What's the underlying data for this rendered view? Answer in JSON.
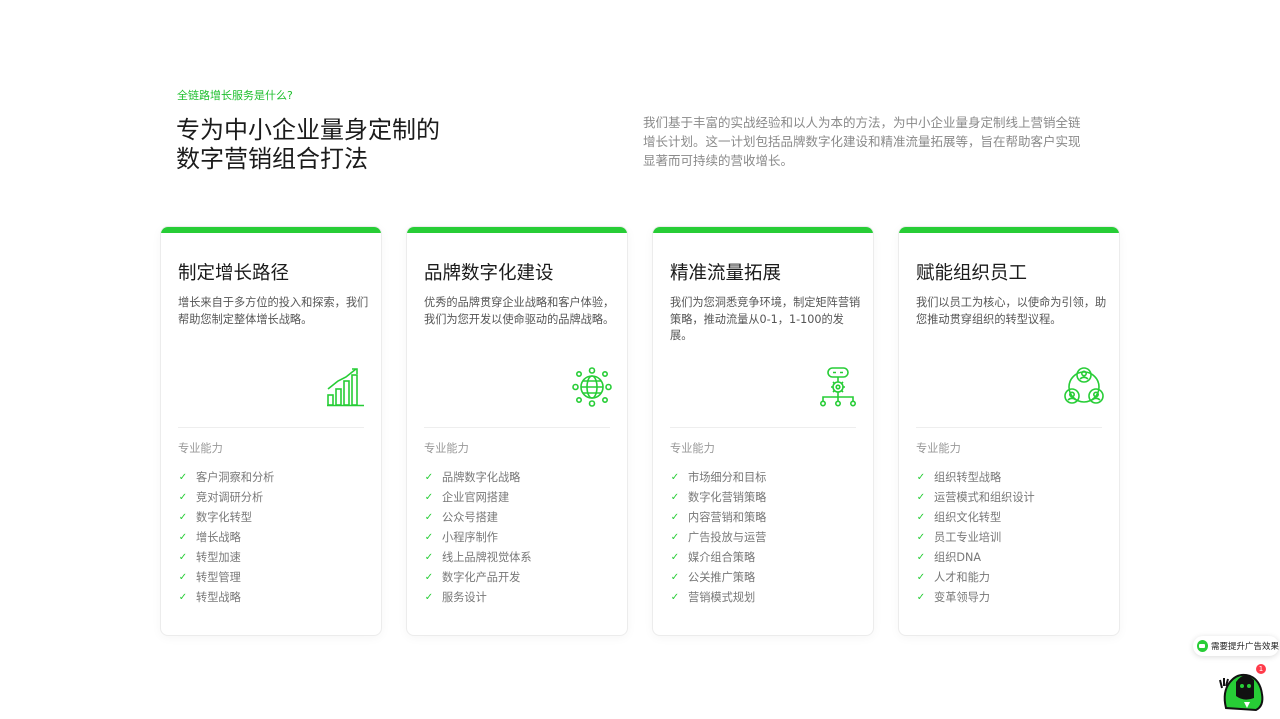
{
  "hero": {
    "eyebrow": "全链路增长服务是什么?",
    "title_line1": "专为中小企业量身定制的",
    "title_line2": "数字营销组合打法",
    "description": "我们基于丰富的实战经验和以人为本的方法，为中小企业量身定制线上营销全链增长计划。这一计划包括品牌数字化建设和精准流量拓展等，旨在帮助客户实现显著而可持续的营收增长。"
  },
  "theme": {
    "accent": "#27cd36",
    "eyebrow_color": "#1fbf2e"
  },
  "cards": [
    {
      "title": "制定增长路径",
      "description": "增长来自于多方位的投入和探索，我们帮助您制定整体增长战略。",
      "icon": "growth-chart-icon",
      "capability_label": "专业能力",
      "items": [
        "客户洞察和分析",
        "竞对调研分析",
        "数字化转型",
        "增长战略",
        "转型加速",
        "转型管理",
        "转型战略"
      ]
    },
    {
      "title": "品牌数字化建设",
      "description": "优秀的品牌贯穿企业战略和客户体验，我们为您开发以使命驱动的品牌战略。",
      "icon": "globe-network-icon",
      "capability_label": "专业能力",
      "items": [
        "品牌数字化战略",
        "企业官网搭建",
        "公众号搭建",
        "小程序制作",
        "线上品牌视觉体系",
        "数字化产品开发",
        "服务设计"
      ]
    },
    {
      "title": "精准流量拓展",
      "description": "我们为您洞悉竞争环境，制定矩阵营销策略，推动流量从0-1，1-100的发展。",
      "icon": "gear-network-icon",
      "capability_label": "专业能力",
      "items": [
        "市场细分和目标",
        "数字化营销策略",
        "内容营销和策略",
        "广告投放与运营",
        "媒介组合策略",
        "公关推广策略",
        "营销模式规划"
      ]
    },
    {
      "title": "赋能组织员工",
      "description": "我们以员工为核心，以使命为引领，助您推动贯穿组织的转型议程。",
      "icon": "team-people-icon",
      "capability_label": "专业能力",
      "items": [
        "组织转型战略",
        "运营模式和组织设计",
        "组织文化转型",
        "员工专业培训",
        "组织DNA",
        "人才和能力",
        "变革领导力"
      ]
    }
  ],
  "check_glyph": "✓",
  "chat_widget": {
    "label": "需要提升广告效果",
    "badge_count": "1"
  }
}
